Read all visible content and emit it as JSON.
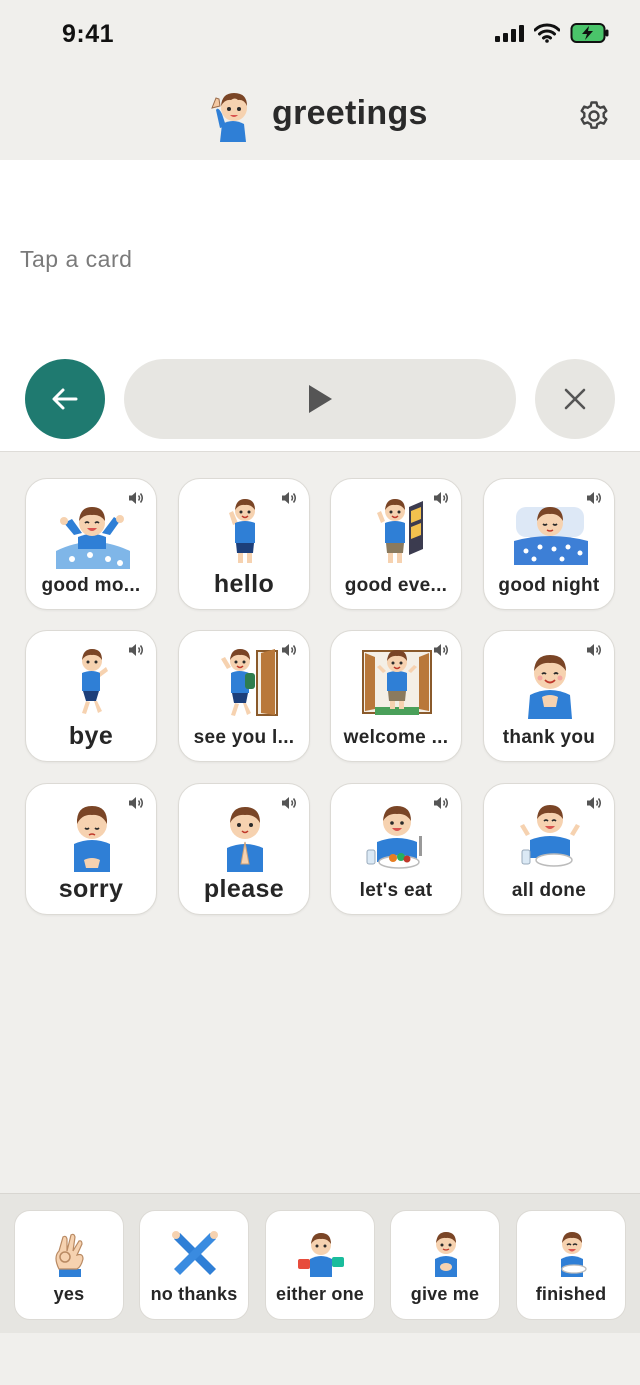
{
  "status": {
    "time": "9:41"
  },
  "header": {
    "title": "greetings",
    "avatar_icon": "boy-waving-icon",
    "settings_icon": "gear-icon"
  },
  "sentence": {
    "placeholder": "Tap a card"
  },
  "controls": {
    "back_icon": "arrow-left-icon",
    "play_icon": "play-icon",
    "clear_icon": "close-icon"
  },
  "colors": {
    "accent": "#1f7a70",
    "shirt": "#2f7fd6",
    "hair": "#7a4526",
    "background": "#f0efec"
  },
  "cards": [
    {
      "label": "good mo...",
      "icon": "boy-waking-up-icon",
      "speaker_icon": "speaker-icon"
    },
    {
      "label": "hello",
      "icon": "boy-waving-icon",
      "speaker_icon": "speaker-icon"
    },
    {
      "label": "good eve...",
      "icon": "boy-at-door-evening-icon",
      "speaker_icon": "speaker-icon"
    },
    {
      "label": "good night",
      "icon": "boy-sleeping-icon",
      "speaker_icon": "speaker-icon"
    },
    {
      "label": "bye",
      "icon": "boy-walking-away-icon",
      "speaker_icon": "speaker-icon"
    },
    {
      "label": "see you l...",
      "icon": "boy-leaving-door-icon",
      "speaker_icon": "speaker-icon"
    },
    {
      "label": "welcome ...",
      "icon": "boy-welcome-door-icon",
      "speaker_icon": "speaker-icon"
    },
    {
      "label": "thank you",
      "icon": "boy-hands-on-chest-icon",
      "speaker_icon": "speaker-icon"
    },
    {
      "label": "sorry",
      "icon": "boy-bowing-icon",
      "speaker_icon": "speaker-icon"
    },
    {
      "label": "please",
      "icon": "boy-praying-hands-icon",
      "speaker_icon": "speaker-icon"
    },
    {
      "label": "let's eat",
      "icon": "boy-eating-icon",
      "speaker_icon": "speaker-icon"
    },
    {
      "label": "all done",
      "icon": "boy-finished-meal-icon",
      "speaker_icon": "speaker-icon"
    }
  ],
  "quick_bar": [
    {
      "label": "yes",
      "icon": "ok-hand-icon"
    },
    {
      "label": "no thanks",
      "icon": "crossed-arms-icon"
    },
    {
      "label": "either one",
      "icon": "boy-holding-two-cards-icon"
    },
    {
      "label": "give me",
      "icon": "boy-reaching-icon"
    },
    {
      "label": "finished",
      "icon": "boy-with-empty-plate-icon"
    }
  ]
}
